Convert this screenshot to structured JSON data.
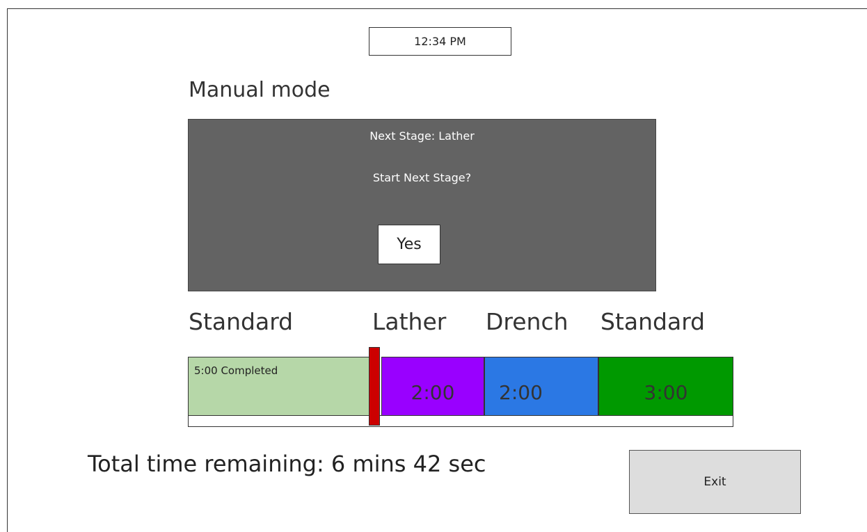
{
  "clock": {
    "time": "12:34 PM"
  },
  "mode": {
    "title": "Manual mode"
  },
  "dialog": {
    "next_stage_text": "Next Stage: Lather",
    "prompt": "Start Next Stage?",
    "yes_label": "Yes"
  },
  "stages": {
    "labels": [
      "Standard",
      "Lather",
      "Drench",
      "Standard"
    ],
    "segments": [
      {
        "name": "Standard",
        "text": "5:00 Completed",
        "color": "#b6d7a8",
        "status": "completed"
      },
      {
        "name": "Lather",
        "text": "2:00",
        "color": "#9900ff",
        "status": "pending"
      },
      {
        "name": "Drench",
        "text": "2:00",
        "color": "#2b78e4",
        "status": "pending"
      },
      {
        "name": "Standard",
        "text": "3:00",
        "color": "#009900",
        "status": "pending"
      }
    ],
    "marker_color": "#cc0000"
  },
  "footer": {
    "total_remaining": "Total time remaining: 6 mins 42 sec",
    "exit_label": "Exit"
  }
}
